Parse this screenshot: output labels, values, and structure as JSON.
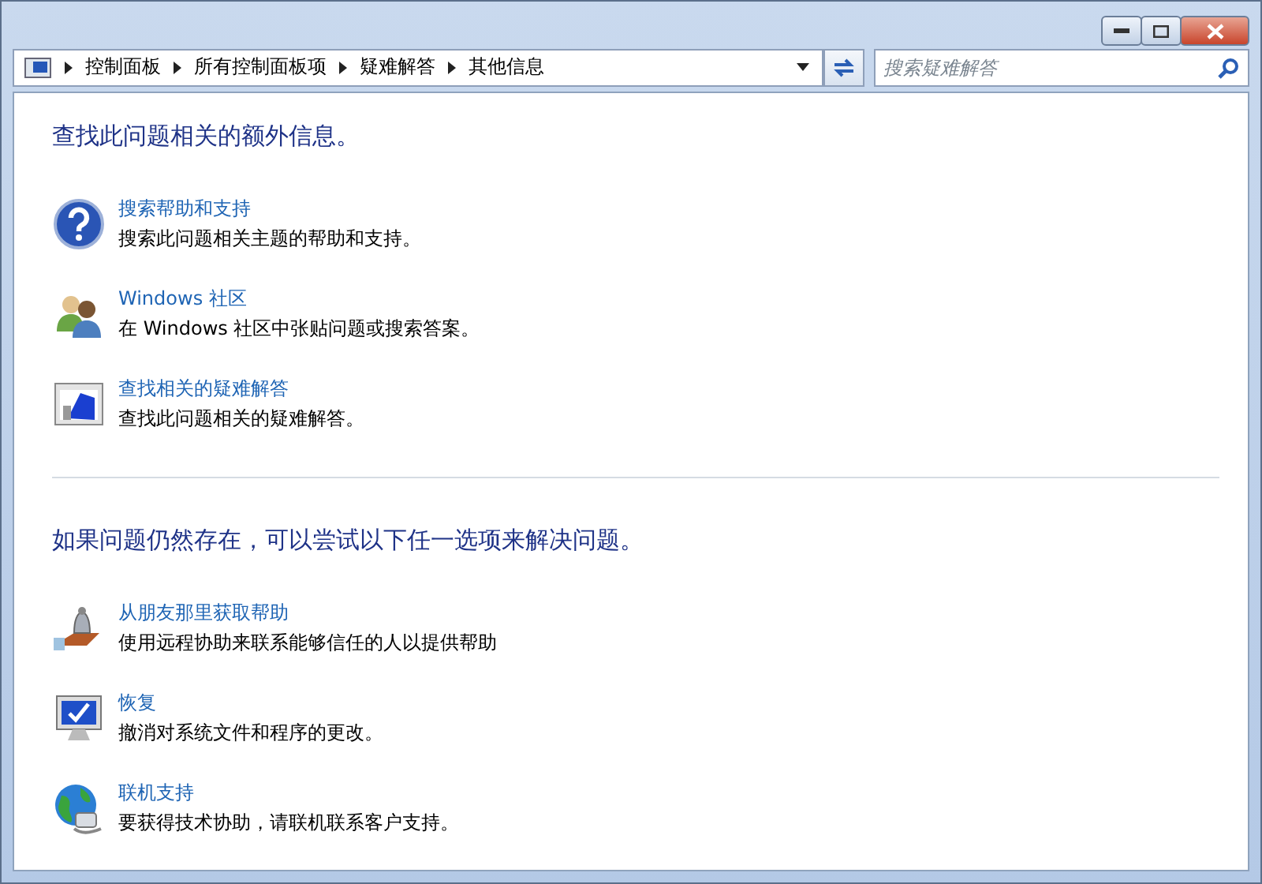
{
  "address_bar": {
    "breadcrumbs": [
      "控制面板",
      "所有控制面板项",
      "疑难解答",
      "其他信息"
    ]
  },
  "search": {
    "placeholder": "搜索疑难解答"
  },
  "sections": [
    {
      "title": "查找此问题相关的额外信息。",
      "items": [
        {
          "kind": "help",
          "link": "搜索帮助和支持",
          "description": "搜索此问题相关主题的帮助和支持。"
        },
        {
          "kind": "community",
          "link": "Windows 社区",
          "description": "在 Windows 社区中张贴问题或搜索答案。"
        },
        {
          "kind": "troubleshoot",
          "link": "查找相关的疑难解答",
          "description": "查找此问题相关的疑难解答。"
        }
      ]
    },
    {
      "title": "如果问题仍然存在，可以尝试以下任一选项来解决问题。",
      "items": [
        {
          "kind": "friend",
          "link": "从朋友那里获取帮助",
          "description": "使用远程协助来联系能够信任的人以提供帮助"
        },
        {
          "kind": "restore",
          "link": "恢复",
          "description": "撤消对系统文件和程序的更改。"
        },
        {
          "kind": "online",
          "link": "联机支持",
          "description": "要获得技术协助，请联机联系客户支持。"
        }
      ]
    }
  ]
}
